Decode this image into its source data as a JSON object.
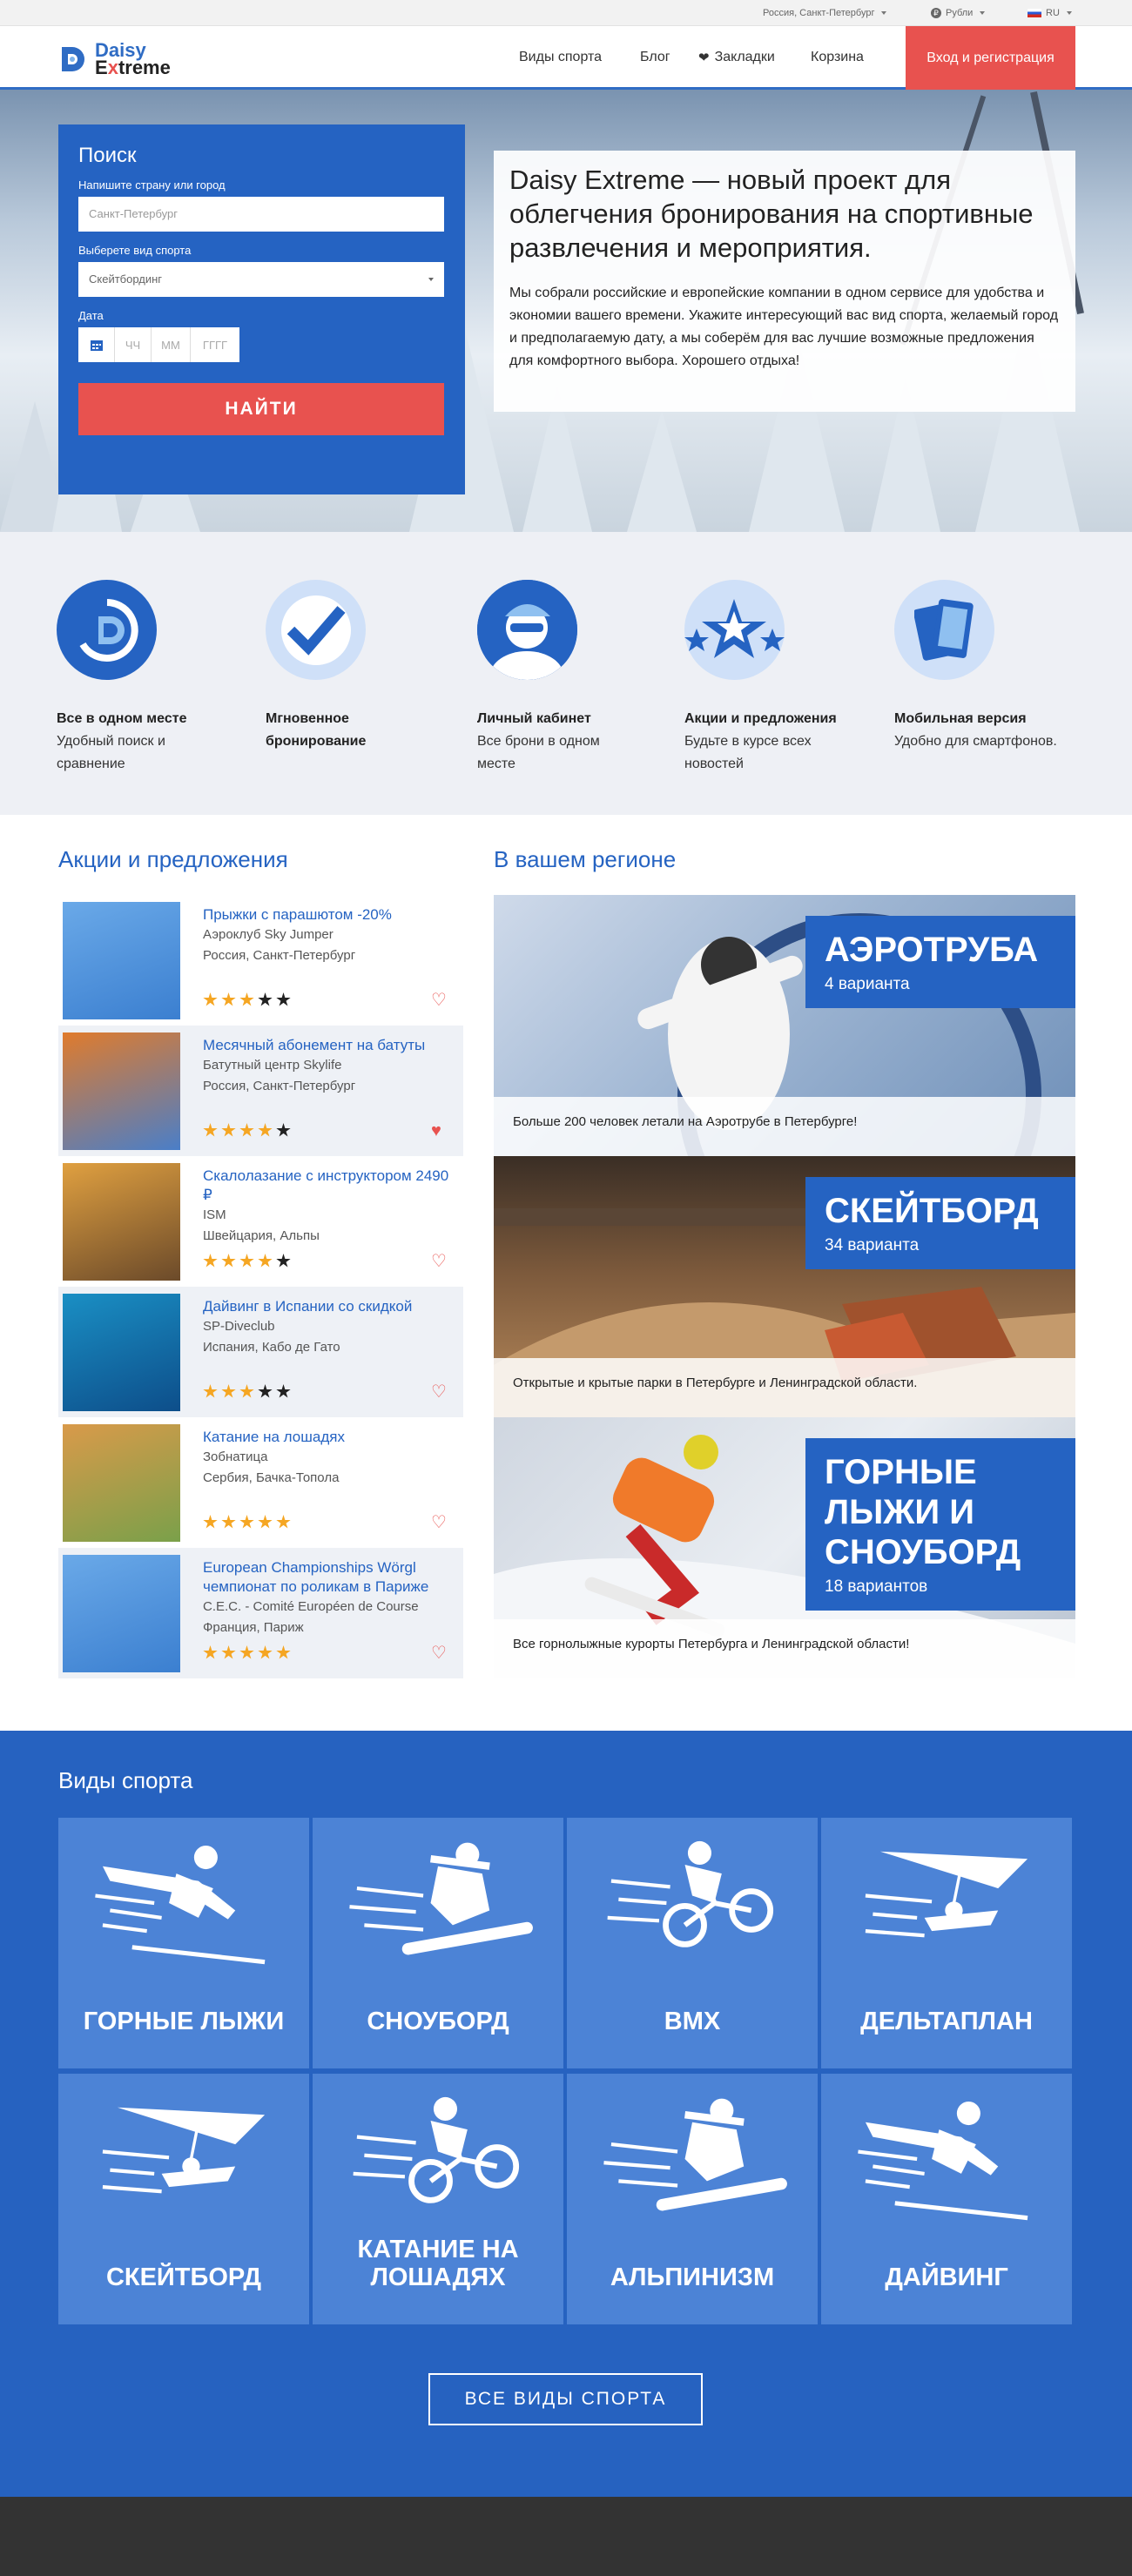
{
  "topbar": {
    "city": "Россия, Санкт-Петербург",
    "currency": "Рубли",
    "language": "RU"
  },
  "header": {
    "logo_line1": "Daisy",
    "logo_line2_a": "E",
    "logo_line2_b": "x",
    "logo_line2_c": "treme",
    "nav": [
      "Виды спорта",
      "Блог",
      "Закладки",
      "Корзина"
    ],
    "login": "Вход и регистрация"
  },
  "search": {
    "title": "Поиск",
    "city_label": "Напишите страну или город",
    "city_placeholder": "Санкт-Петербург",
    "sport_label": "Выберете вид спорта",
    "sport_value": "Скейтбординг",
    "date_label": "Дата",
    "date_dd": "ЧЧ",
    "date_mm": "ММ",
    "date_yyyy": "ГГГГ",
    "button": "НАЙТИ"
  },
  "hero": {
    "title": "Daisy Extreme — новый проект для облегчения бронирования на спортивные развлечения и мероприятия.",
    "text": "Мы собрали российские и европейские компании в одном сервисе для удобства и экономии вашего времени. Укажите интересующий вас вид спорта, желаемый город и предполагаемую дату, а мы соберём для вас лучшие возможные предложения для комфортного выбора. Хорошего отдыха!"
  },
  "features": [
    {
      "icon": "logo-swirl-icon",
      "title": "Все в одном месте",
      "desc": "Удобный поиск и сравнение"
    },
    {
      "icon": "checkmark-icon",
      "title": "Мгновенное бронирование",
      "desc": ""
    },
    {
      "icon": "user-avatar-icon",
      "title": "Личный кабинет",
      "desc": "Все брони в одном месте"
    },
    {
      "icon": "stars-icon",
      "title": "Акции и предложения",
      "desc": "Будьте в курсе всех новостей"
    },
    {
      "icon": "mobile-devices-icon",
      "title": "Мобильная версия",
      "desc": "Удобно для смартфонов."
    }
  ],
  "promos_title": "Акции и предложения",
  "promos": [
    {
      "title": "Прыжки с парашютом -20%",
      "org": "Аэроклуб Sky Jumper",
      "place": "Россия, Санкт-Петербург",
      "rating": 3,
      "fav": false
    },
    {
      "title": "Месячный абонемент на батуты",
      "org": "Батутный центр Skylife",
      "place": "Россия, Санкт-Петербург",
      "rating": 4,
      "fav": true
    },
    {
      "title": "Скалолазание с инструктором 2490 ₽",
      "org": "ISM",
      "place": "Швейцария, Альпы",
      "rating": 4,
      "fav": false
    },
    {
      "title": "Дайвинг в Испании со скидкой",
      "org": "SP-Diveclub",
      "place": "Испания,  Кабо де Гато",
      "rating": 3,
      "fav": false
    },
    {
      "title": "Катание на лошадях",
      "org": "Зобнатица",
      "place": "Сербия, Бачка-Топола",
      "rating": 5,
      "fav": false
    },
    {
      "title": "European Championships Wörgl чемпионат по роликам в Париже",
      "org": "C.E.C. - Comité Européen de Course",
      "place": "Франция, Париж",
      "rating": 5,
      "fav": false
    }
  ],
  "region_title": "В вашем регионе",
  "regions": [
    {
      "name": "АЭРОТРУБА",
      "count": "4 варианта",
      "caption": "Больше 200 человек летали на Аэротрубе в Петербурге!"
    },
    {
      "name": "СКЕЙТБОРД",
      "count": "34 варианта",
      "caption": "Открытые и крытые парки в Петербурге и Ленинградской области."
    },
    {
      "name": "ГОРНЫЕ ЛЫЖИ И СНОУБОРД",
      "count": "18 вариантов",
      "caption": "Все горнолыжные курорты Петербурга и Ленинградской области!"
    }
  ],
  "sports": {
    "title": "Виды спорта",
    "tiles": [
      {
        "label": "ГОРНЫЕ ЛЫЖИ",
        "icon": "skier-icon"
      },
      {
        "label": "СНОУБОРД",
        "icon": "snowboarder-icon"
      },
      {
        "label": "BMX",
        "icon": "bmx-icon"
      },
      {
        "label": "ДЕЛЬТАПЛАН",
        "icon": "hang-glider-icon"
      },
      {
        "label": "СКЕЙТБОРД",
        "icon": "hang-glider-icon"
      },
      {
        "label": "КАТАНИЕ НА ЛОШАДЯХ",
        "icon": "bmx-icon"
      },
      {
        "label": "АЛЬПИНИЗМ",
        "icon": "snowboarder-icon"
      },
      {
        "label": "ДАЙВИНГ",
        "icon": "skier-icon"
      }
    ],
    "all_button": "ВСЕ ВИДЫ СПОРТА"
  }
}
